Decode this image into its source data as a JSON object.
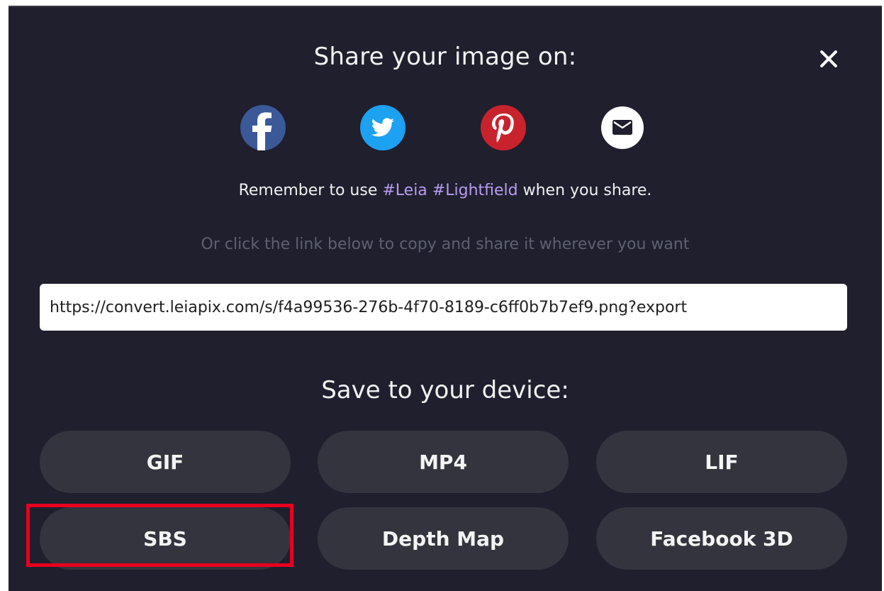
{
  "dialog": {
    "share_title": "Share your image on:",
    "close_label": "×",
    "hashtag_prefix": "Remember to use ",
    "hashtag_leia": "#Leia",
    "hashtag_lightfield": "#Lightfield",
    "hashtag_suffix": " when you share.",
    "copy_hint": "Or click the link below to copy and share it wherever you want",
    "share_link": "https://convert.leiapix.com/s/f4a99536-276b-4f70-8189-c6ff0b7b7ef9.png?export",
    "save_title": "Save to your device:"
  },
  "social": [
    {
      "name": "facebook",
      "icon": "facebook-icon",
      "color": "#3b5998"
    },
    {
      "name": "twitter",
      "icon": "twitter-icon",
      "color": "#1da1f2"
    },
    {
      "name": "pinterest",
      "icon": "pinterest-icon",
      "color": "#c8232c"
    },
    {
      "name": "email",
      "icon": "email-icon",
      "color": "#ffffff"
    }
  ],
  "save_buttons": {
    "gif": "GIF",
    "mp4": "MP4",
    "lif": "LIF",
    "sbs": "SBS",
    "depth_map": "Depth Map",
    "facebook_3d": "Facebook 3D"
  },
  "colors": {
    "background": "#1f1f2e",
    "button": "#34343f",
    "hashtag": "#b89cf0",
    "highlight": "#e8001e"
  }
}
